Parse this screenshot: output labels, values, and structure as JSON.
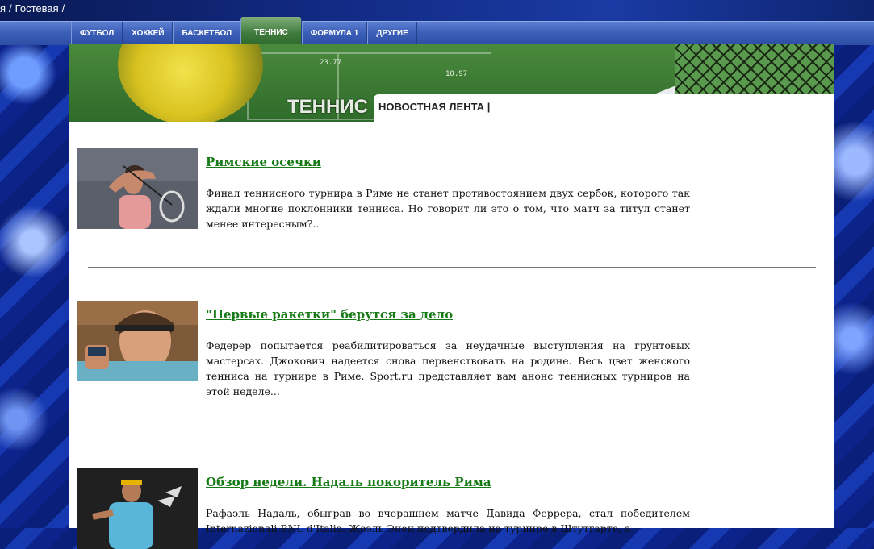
{
  "breadcrumb": {
    "items": [
      "я",
      "Гостевая"
    ]
  },
  "nav": {
    "tabs": [
      {
        "label": "ФУТБОЛ"
      },
      {
        "label": "ХОККЕЙ"
      },
      {
        "label": "БАСКЕТБОЛ"
      },
      {
        "label": "ТЕННИС"
      },
      {
        "label": "ФОРМУЛА 1"
      },
      {
        "label": "ДРУГИЕ"
      }
    ],
    "active_tab": "ТЕННИС"
  },
  "banner": {
    "section_title": "ТЕННИС",
    "feed_label": "НОВОСТНАЯ ЛЕНТА |",
    "score_a": "23.77",
    "score_b": "10.97"
  },
  "articles": [
    {
      "title": "Римские осечки",
      "text": "Финал теннисного турнира в Риме не станет противостоянием двух сербок, которого так ждали многие поклонники тенниса. Но говорит ли это о том, что матч за титул станет менее интересным?.."
    },
    {
      "title": "\"Первые ракетки\" берутся за дело",
      "text": "Федерер попытается реабилитироваться за неудачные выступления на грунтовых мастерсах. Джокович надеется снова первенствовать на родине. Весь цвет женского тенниса на турнире в Риме. Sport.ru представляет вам анонс теннисных турниров на этой неделе..."
    },
    {
      "title": "Обзор недели. Надаль покоритель Рима",
      "text": "Рафаэль Надаль, обыграв во вчерашнем матче Давида Феррера, стал победителем Internazionali BNL d'Italia. Жоэль Энен подтвердила на турнире в Штутгарте, а"
    }
  ],
  "colors": {
    "title_green": "#177a17",
    "nav_blue": "#3a5db7",
    "active_green": "#3e7a3b"
  }
}
